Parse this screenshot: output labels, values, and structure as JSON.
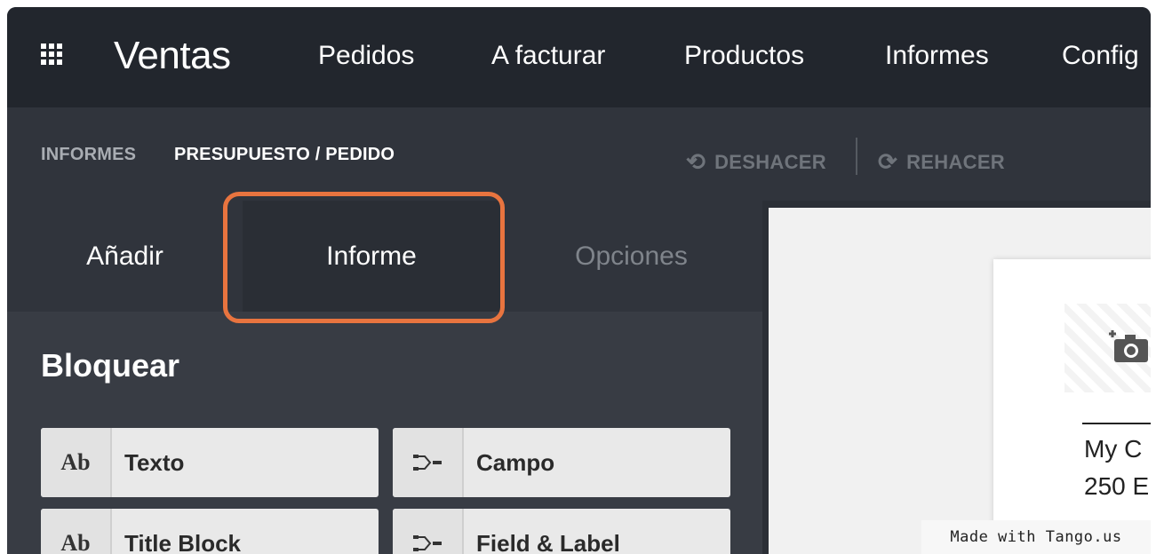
{
  "navbar": {
    "app_icon": "apps-grid-icon",
    "brand": "Ventas",
    "menu": [
      "Pedidos",
      "A facturar",
      "Productos",
      "Informes",
      "Config"
    ]
  },
  "breadcrumb": {
    "parent": "INFORMES",
    "current": "PRESUPUESTO / PEDIDO"
  },
  "toolbar": {
    "undo_label": "DESHACER",
    "undo_icon": "undo-icon",
    "redo_label": "REHACER",
    "redo_icon": "redo-icon"
  },
  "tabs": {
    "add": "Añadir",
    "report": "Informe",
    "options": "Opciones",
    "highlight_color": "#e8743f"
  },
  "blocks_section": {
    "title": "Bloquear",
    "items": [
      {
        "icon_text": "Ab",
        "icon": "text-icon",
        "label": "Texto"
      },
      {
        "icon": "field-icon",
        "label": "Campo"
      },
      {
        "icon_text": "Ab",
        "icon": "text-icon",
        "label": "Title Block"
      },
      {
        "icon": "field-icon",
        "label": "Field & Label"
      }
    ]
  },
  "preview": {
    "logo_icon": "add-photo-icon",
    "company_line": "My C",
    "address_line": "250 E"
  },
  "watermark": "Made with Tango.us",
  "colors": {
    "navbar_bg": "#22262d",
    "panel_bg": "#383c44",
    "accent": "#e8743f"
  }
}
